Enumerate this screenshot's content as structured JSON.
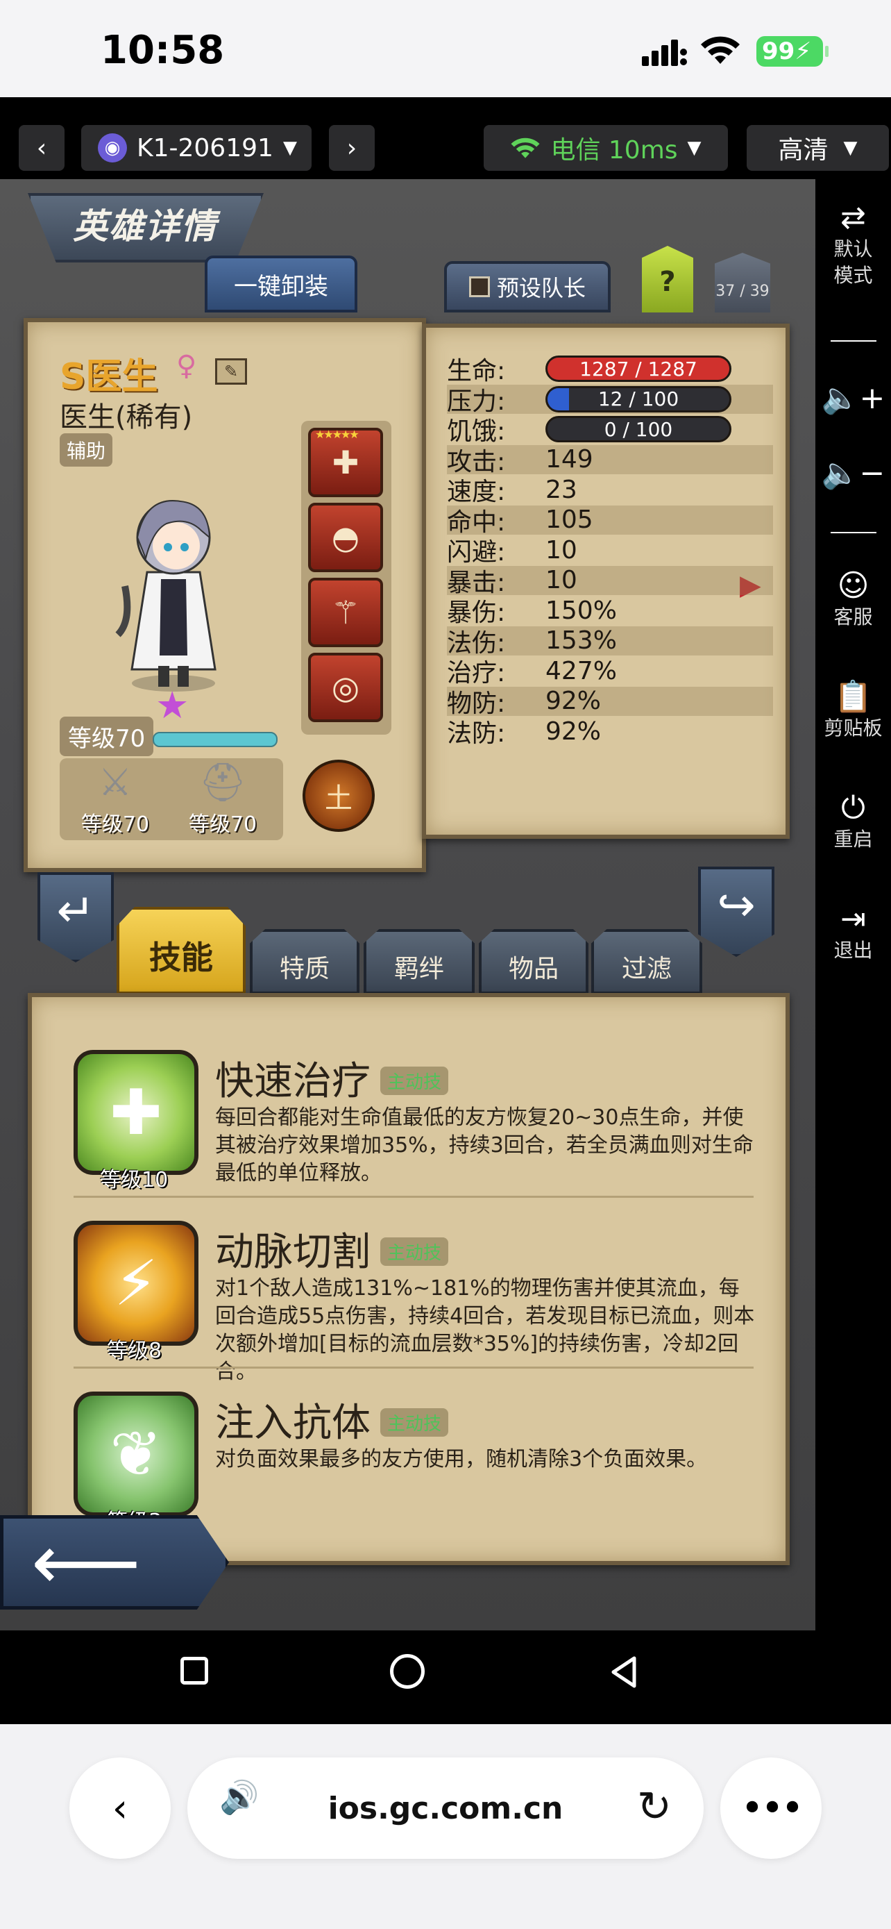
{
  "status_bar": {
    "time": "10:58",
    "battery": "99"
  },
  "toolbar": {
    "device_id": "K1-206191",
    "network": "电信 10ms",
    "quality": "高清"
  },
  "sidebar": {
    "items": [
      {
        "label": "默认\n模式",
        "icon": "swap-icon"
      },
      {
        "label": "",
        "icon": "volume-up-icon"
      },
      {
        "label": "",
        "icon": "volume-down-icon"
      },
      {
        "label": "客服",
        "icon": "support-icon"
      },
      {
        "label": "剪贴板",
        "icon": "clipboard-icon"
      },
      {
        "label": "重启",
        "icon": "power-icon"
      },
      {
        "label": "退出",
        "icon": "exit-icon"
      }
    ]
  },
  "game": {
    "header_title": "英雄详情",
    "unequip_all": "一键卸装",
    "preset_captain": "预设队长",
    "help": "?",
    "hero_count": "37 / 39",
    "hero": {
      "name": "S医生",
      "class": "医生(稀有)",
      "role": "辅助",
      "level": "等级70",
      "weapon_level": "等级70",
      "armor_level": "等级70",
      "element": "土"
    },
    "stats": [
      {
        "label": "生命:",
        "value": "1287 / 1287",
        "type": "bar",
        "fill": 1.0,
        "color": "#d0312d"
      },
      {
        "label": "压力:",
        "value": "12 / 100",
        "type": "bar",
        "fill": 0.12,
        "color": "#2f5fd0"
      },
      {
        "label": "饥饿:",
        "value": "0 / 100",
        "type": "bar",
        "fill": 0.0,
        "color": "#444"
      },
      {
        "label": "攻击:",
        "value": "149"
      },
      {
        "label": "速度:",
        "value": "23"
      },
      {
        "label": "命中:",
        "value": "105"
      },
      {
        "label": "闪避:",
        "value": "10"
      },
      {
        "label": "暴击:",
        "value": "10"
      },
      {
        "label": "暴伤:",
        "value": "150%"
      },
      {
        "label": "法伤:",
        "value": "153%"
      },
      {
        "label": "治疗:",
        "value": "427%"
      },
      {
        "label": "物防:",
        "value": "92%"
      },
      {
        "label": "法防:",
        "value": "92%"
      }
    ],
    "tabs": [
      "技能",
      "特质",
      "羁绊",
      "物品",
      "过滤"
    ],
    "skills": [
      {
        "name": "快速治疗",
        "tag": "主动技",
        "level": "等级10",
        "desc": "每回合都能对生命值最低的友方恢复20~30点生命，并使其被治疗效果增加35%，持续3回合，若全员满血则对生命最低的单位释放。"
      },
      {
        "name": "动脉切割",
        "tag": "主动技",
        "level": "等级8",
        "desc": "对1个敌人造成131%~181%的物理伤害并使其流血，每回合造成55点伤害，持续4回合，若发现目标已流血，则本次额外增加[目标的流血层数*35%]的持续伤害，冷却2回合。"
      },
      {
        "name": "注入抗体",
        "tag": "主动技",
        "level": "等级3",
        "desc": "对负面效果最多的友方使用，随机清除3个负面效果。"
      }
    ]
  },
  "browser": {
    "url": "ios.gc.com.cn"
  }
}
